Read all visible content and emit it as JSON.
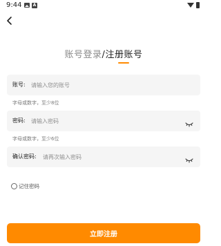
{
  "status_bar": {
    "time": "9:44"
  },
  "header": {
    "login_tab": "账号登录",
    "separator": "/",
    "register_tab": "注册账号"
  },
  "form": {
    "account": {
      "label": "账号:",
      "placeholder": "请输入您的账号",
      "value": "",
      "hint": "字母或数字，至少8位"
    },
    "password": {
      "label": "密码:",
      "placeholder": "请输入密码",
      "value": "",
      "hint": "字母或数字，至少6位"
    },
    "confirm": {
      "label": "确认密码:",
      "placeholder": "请再次输入密码",
      "value": ""
    },
    "remember": {
      "label": "记住密码",
      "checked": false
    }
  },
  "submit_label": "立即注册",
  "colors": {
    "accent": "#ff8a00",
    "field_bg": "#f5f5f5",
    "hint": "#7a7a7a"
  },
  "icons": [
    "image-icon",
    "a-icon",
    "wifi-icon",
    "battery-icon",
    "back-arrow-icon",
    "eye-closed-icon",
    "radio-icon"
  ]
}
